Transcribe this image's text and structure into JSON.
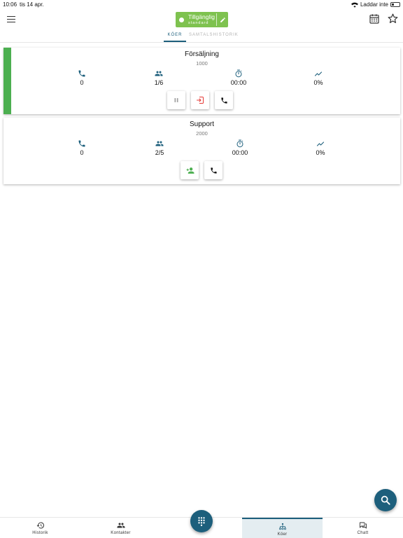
{
  "status_bar": {
    "time": "10:06",
    "date": "tis 14 apr.",
    "charging_label": "Laddar inte"
  },
  "header": {
    "status_label": "Tillgänglig",
    "status_sub": "standard"
  },
  "tabs": [
    {
      "label": "KÖER"
    },
    {
      "label": "SAMTALSHISTORIK"
    }
  ],
  "queues": [
    {
      "name": "Försäljning",
      "code": "1000",
      "calls": "0",
      "agents": "1/6",
      "wait": "00:00",
      "rate": "0%"
    },
    {
      "name": "Support",
      "code": "2000",
      "calls": "0",
      "agents": "2/5",
      "wait": "00:00",
      "rate": "0%"
    }
  ],
  "nav": [
    {
      "label": "Historik"
    },
    {
      "label": "Kontakter"
    },
    {
      "label": "Köer"
    },
    {
      "label": "Chatt"
    }
  ],
  "colors": {
    "primary": "#1d5f7c",
    "available": "#7ec24f",
    "accent_green": "#4caf50",
    "logout_red": "#e53935"
  },
  "icons": [
    "menu-icon",
    "edit-icon",
    "calendar-icon",
    "star-icon",
    "phone-icon",
    "people-icon",
    "timer-icon",
    "trend-icon",
    "pause-icon",
    "logout-icon",
    "add-person-icon",
    "search-icon",
    "history-icon",
    "contacts-icon",
    "queues-icon",
    "chat-icon",
    "dialpad-icon"
  ]
}
